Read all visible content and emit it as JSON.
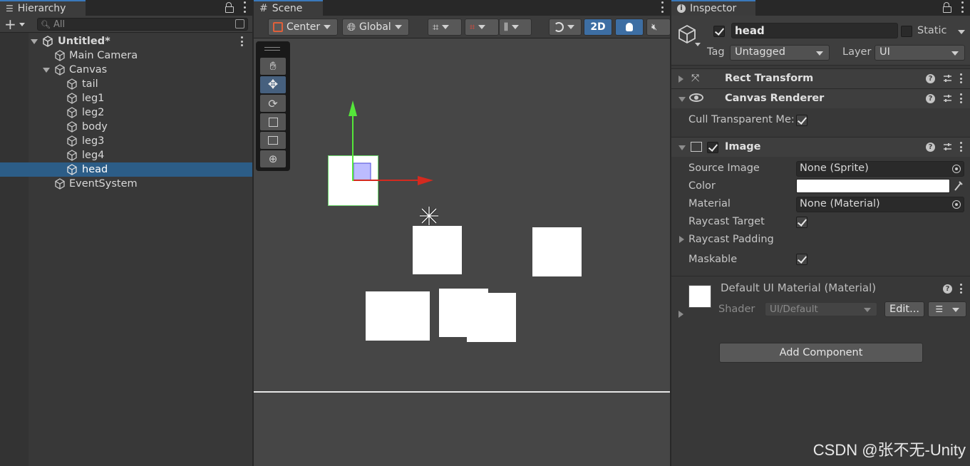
{
  "hierarchy": {
    "tab_label": "Hierarchy",
    "search_placeholder": "All",
    "scene_name": "Untitled*",
    "items": [
      {
        "label": "Main Camera"
      },
      {
        "label": "Canvas"
      },
      {
        "label": "tail"
      },
      {
        "label": "leg1"
      },
      {
        "label": "leg2"
      },
      {
        "label": "body"
      },
      {
        "label": "leg3"
      },
      {
        "label": "leg4"
      },
      {
        "label": "head",
        "selected": true
      },
      {
        "label": "EventSystem"
      }
    ]
  },
  "scene": {
    "tab_label": "Scene",
    "pivot_mode": "Center",
    "pivot_rotation": "Global",
    "mode_2d": "2D"
  },
  "inspector": {
    "tab_label": "Inspector",
    "object_name": "head",
    "static_label": "Static",
    "tag_label": "Tag",
    "tag_value": "Untagged",
    "layer_label": "Layer",
    "layer_value": "UI",
    "components": {
      "rect_transform": "Rect Transform",
      "canvas_renderer": "Canvas Renderer",
      "cull_label": "Cull Transparent Me:",
      "image": "Image"
    },
    "image_props": {
      "source_image_label": "Source Image",
      "source_image_value": "None (Sprite)",
      "color_label": "Color",
      "material_label": "Material",
      "material_value": "None (Material)",
      "raycast_target_label": "Raycast Target",
      "raycast_padding_label": "Raycast Padding",
      "maskable_label": "Maskable"
    },
    "material_section": {
      "title": "Default UI Material (Material)",
      "shader_label": "Shader",
      "shader_value": "UI/Default",
      "edit_button": "Edit..."
    },
    "add_component": "Add Component"
  },
  "watermark": "CSDN @张不无-Unity",
  "colors": {
    "selection": "#2c5d87",
    "accent_blue": "#3d6ea3",
    "gizmo_x": "#d42a1f",
    "gizmo_y": "#55e63a"
  }
}
